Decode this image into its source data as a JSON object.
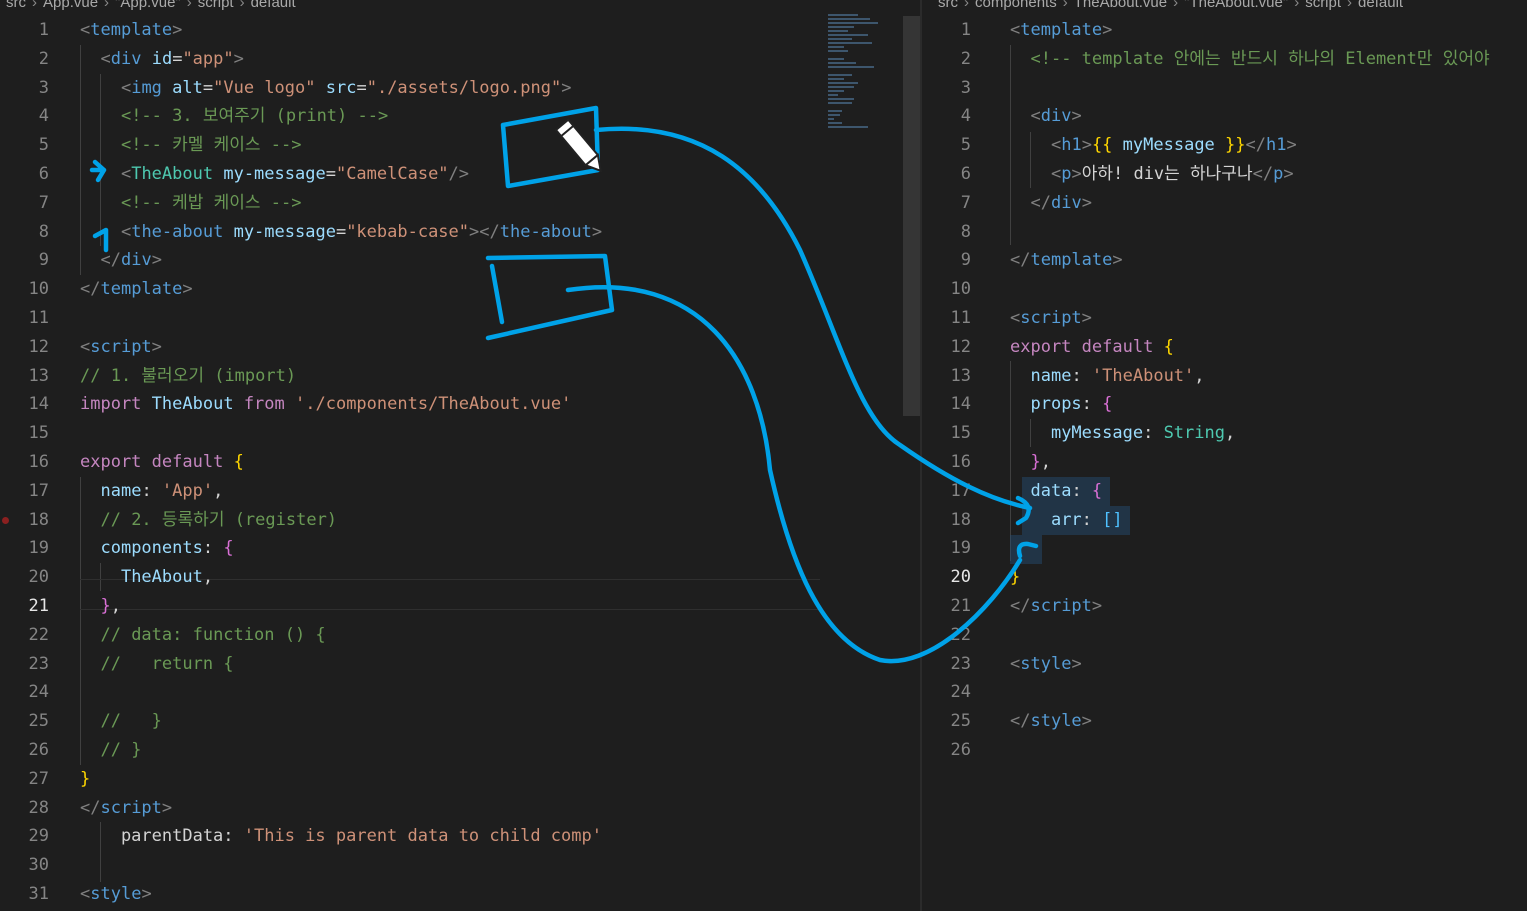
{
  "left_editor": {
    "breadcrumb": [
      "src",
      "App.vue",
      "\"App.vue\"",
      "script",
      "default"
    ],
    "active_line": 21,
    "lines": [
      {
        "n": 1,
        "segs": [
          [
            "t-br",
            "<"
          ],
          [
            "t-tag",
            "template"
          ],
          [
            "t-br",
            ">"
          ]
        ]
      },
      {
        "n": 2,
        "segs": [
          [
            "t-pl",
            "  "
          ],
          [
            "t-br",
            "<"
          ],
          [
            "t-tag",
            "div"
          ],
          [
            "t-pl",
            " "
          ],
          [
            "t-attr",
            "id"
          ],
          [
            "t-pl",
            "="
          ],
          [
            "t-str",
            "\"app\""
          ],
          [
            "t-br",
            ">"
          ]
        ]
      },
      {
        "n": 3,
        "segs": [
          [
            "t-pl",
            "    "
          ],
          [
            "t-br",
            "<"
          ],
          [
            "t-tag",
            "img"
          ],
          [
            "t-pl",
            " "
          ],
          [
            "t-attr",
            "alt"
          ],
          [
            "t-pl",
            "="
          ],
          [
            "t-str",
            "\"Vue logo\""
          ],
          [
            "t-pl",
            " "
          ],
          [
            "t-attr",
            "src"
          ],
          [
            "t-pl",
            "="
          ],
          [
            "t-str",
            "\"./assets/logo.png\""
          ],
          [
            "t-br",
            ">"
          ]
        ]
      },
      {
        "n": 4,
        "segs": [
          [
            "t-pl",
            "    "
          ],
          [
            "t-cmt",
            "<!-- 3. 보여주기 (print) -->"
          ]
        ]
      },
      {
        "n": 5,
        "segs": [
          [
            "t-pl",
            "    "
          ],
          [
            "t-cmt",
            "<!-- 카멜 케이스 -->"
          ]
        ]
      },
      {
        "n": 6,
        "segs": [
          [
            "t-pl",
            "    "
          ],
          [
            "t-br",
            "<"
          ],
          [
            "t-cls",
            "TheAbout"
          ],
          [
            "t-pl",
            " "
          ],
          [
            "t-attr",
            "my-message"
          ],
          [
            "t-pl",
            "="
          ],
          [
            "t-str",
            "\"CamelCase\""
          ],
          [
            "t-br",
            "/>"
          ]
        ]
      },
      {
        "n": 7,
        "segs": [
          [
            "t-pl",
            "    "
          ],
          [
            "t-cmt",
            "<!-- 케밥 케이스 -->"
          ]
        ]
      },
      {
        "n": 8,
        "segs": [
          [
            "t-pl",
            "    "
          ],
          [
            "t-br",
            "<"
          ],
          [
            "t-tag",
            "the-about"
          ],
          [
            "t-pl",
            " "
          ],
          [
            "t-attr",
            "my-message"
          ],
          [
            "t-pl",
            "="
          ],
          [
            "t-str",
            "\"kebab-case\""
          ],
          [
            "t-br",
            "></"
          ],
          [
            "t-tag",
            "the-about"
          ],
          [
            "t-br",
            ">"
          ]
        ]
      },
      {
        "n": 9,
        "segs": [
          [
            "t-pl",
            "  "
          ],
          [
            "t-br",
            "</"
          ],
          [
            "t-tag",
            "div"
          ],
          [
            "t-br",
            ">"
          ]
        ]
      },
      {
        "n": 10,
        "segs": [
          [
            "t-br",
            "</"
          ],
          [
            "t-tag",
            "template"
          ],
          [
            "t-br",
            ">"
          ]
        ]
      },
      {
        "n": 11,
        "segs": []
      },
      {
        "n": 12,
        "segs": [
          [
            "t-br",
            "<"
          ],
          [
            "t-tag",
            "script"
          ],
          [
            "t-br",
            ">"
          ]
        ]
      },
      {
        "n": 13,
        "segs": [
          [
            "t-cmt",
            "// 1. 불러오기 (import)"
          ]
        ]
      },
      {
        "n": 14,
        "segs": [
          [
            "t-kw",
            "import"
          ],
          [
            "t-pl",
            " "
          ],
          [
            "t-var",
            "TheAbout"
          ],
          [
            "t-pl",
            " "
          ],
          [
            "t-kw",
            "from"
          ],
          [
            "t-pl",
            " "
          ],
          [
            "t-str",
            "'./components/TheAbout.vue'"
          ]
        ]
      },
      {
        "n": 15,
        "segs": []
      },
      {
        "n": 16,
        "segs": [
          [
            "t-kw",
            "export"
          ],
          [
            "t-pl",
            " "
          ],
          [
            "t-kw",
            "default"
          ],
          [
            "t-pl",
            " "
          ],
          [
            "t-ye",
            "{"
          ]
        ]
      },
      {
        "n": 17,
        "segs": [
          [
            "t-pl",
            "  "
          ],
          [
            "t-var",
            "name"
          ],
          [
            "t-pl",
            ": "
          ],
          [
            "t-str",
            "'App'"
          ],
          [
            "t-pl",
            ","
          ]
        ]
      },
      {
        "n": 18,
        "segs": [
          [
            "t-pl",
            "  "
          ],
          [
            "t-cmt",
            "// 2. 등록하기 (register)"
          ]
        ]
      },
      {
        "n": 19,
        "segs": [
          [
            "t-pl",
            "  "
          ],
          [
            "t-var",
            "components"
          ],
          [
            "t-pl",
            ": "
          ],
          [
            "t-pu",
            "{"
          ]
        ]
      },
      {
        "n": 20,
        "segs": [
          [
            "t-pl",
            "    "
          ],
          [
            "t-var",
            "TheAbout"
          ],
          [
            "t-pl",
            ","
          ]
        ]
      },
      {
        "n": 21,
        "segs": [
          [
            "t-pl",
            "  "
          ],
          [
            "t-pu",
            "}"
          ],
          [
            "t-pl",
            ","
          ]
        ]
      },
      {
        "n": 22,
        "segs": [
          [
            "t-pl",
            "  "
          ],
          [
            "t-cmt",
            "// data: function () {"
          ]
        ]
      },
      {
        "n": 23,
        "segs": [
          [
            "t-pl",
            "  "
          ],
          [
            "t-cmt",
            "//   return {"
          ]
        ]
      },
      {
        "n": 24,
        "segs": []
      },
      {
        "n": 25,
        "segs": [
          [
            "t-pl",
            "  "
          ],
          [
            "t-cmt",
            "//   }"
          ]
        ]
      },
      {
        "n": 26,
        "segs": [
          [
            "t-pl",
            "  "
          ],
          [
            "t-cmt",
            "// }"
          ]
        ]
      },
      {
        "n": 27,
        "segs": [
          [
            "t-ye",
            "}"
          ]
        ]
      },
      {
        "n": 28,
        "segs": [
          [
            "t-br",
            "</"
          ],
          [
            "t-tag",
            "script"
          ],
          [
            "t-br",
            ">"
          ]
        ]
      },
      {
        "n": 29,
        "segs": [
          [
            "t-pl",
            "    parentData: "
          ],
          [
            "t-str",
            "'This is parent data to child comp'"
          ]
        ]
      },
      {
        "n": 30,
        "segs": []
      },
      {
        "n": 31,
        "segs": [
          [
            "t-br",
            "<"
          ],
          [
            "t-tag",
            "style"
          ],
          [
            "t-br",
            ">"
          ]
        ]
      }
    ]
  },
  "right_editor": {
    "breadcrumb": [
      "src",
      "components",
      "TheAbout.vue",
      "\"TheAbout.vue\"",
      "script",
      "default"
    ],
    "active_line": 20,
    "lines": [
      {
        "n": 1,
        "segs": [
          [
            "t-br",
            "<"
          ],
          [
            "t-tag",
            "template"
          ],
          [
            "t-br",
            ">"
          ]
        ]
      },
      {
        "n": 2,
        "segs": [
          [
            "t-pl",
            "  "
          ],
          [
            "t-cmt",
            "<!-- template 안에는 반드시 하나의 Element만 있어야"
          ]
        ]
      },
      {
        "n": 3,
        "segs": []
      },
      {
        "n": 4,
        "segs": [
          [
            "t-pl",
            "  "
          ],
          [
            "t-br",
            "<"
          ],
          [
            "t-tag",
            "div"
          ],
          [
            "t-br",
            ">"
          ]
        ]
      },
      {
        "n": 5,
        "segs": [
          [
            "t-pl",
            "    "
          ],
          [
            "t-br",
            "<"
          ],
          [
            "t-tag",
            "h1"
          ],
          [
            "t-br",
            ">"
          ],
          [
            "t-ye",
            "{{"
          ],
          [
            "t-pl",
            " "
          ],
          [
            "t-var",
            "myMessage"
          ],
          [
            "t-pl",
            " "
          ],
          [
            "t-ye",
            "}}"
          ],
          [
            "t-br",
            "</"
          ],
          [
            "t-tag",
            "h1"
          ],
          [
            "t-br",
            ">"
          ]
        ]
      },
      {
        "n": 6,
        "segs": [
          [
            "t-pl",
            "    "
          ],
          [
            "t-br",
            "<"
          ],
          [
            "t-tag",
            "p"
          ],
          [
            "t-br",
            ">"
          ],
          [
            "t-pl",
            "아하! div는 하나구나"
          ],
          [
            "t-br",
            "</"
          ],
          [
            "t-tag",
            "p"
          ],
          [
            "t-br",
            ">"
          ]
        ]
      },
      {
        "n": 7,
        "segs": [
          [
            "t-pl",
            "  "
          ],
          [
            "t-br",
            "</"
          ],
          [
            "t-tag",
            "div"
          ],
          [
            "t-br",
            ">"
          ]
        ]
      },
      {
        "n": 8,
        "segs": []
      },
      {
        "n": 9,
        "segs": [
          [
            "t-br",
            "</"
          ],
          [
            "t-tag",
            "template"
          ],
          [
            "t-br",
            ">"
          ]
        ]
      },
      {
        "n": 10,
        "segs": []
      },
      {
        "n": 11,
        "segs": [
          [
            "t-br",
            "<"
          ],
          [
            "t-tag",
            "script"
          ],
          [
            "t-br",
            ">"
          ]
        ]
      },
      {
        "n": 12,
        "segs": [
          [
            "t-kw",
            "export"
          ],
          [
            "t-pl",
            " "
          ],
          [
            "t-kw",
            "default"
          ],
          [
            "t-pl",
            " "
          ],
          [
            "t-ye",
            "{"
          ]
        ]
      },
      {
        "n": 13,
        "segs": [
          [
            "t-pl",
            "  "
          ],
          [
            "t-var",
            "name"
          ],
          [
            "t-pl",
            ": "
          ],
          [
            "t-str",
            "'TheAbout'"
          ],
          [
            "t-pl",
            ","
          ]
        ]
      },
      {
        "n": 14,
        "segs": [
          [
            "t-pl",
            "  "
          ],
          [
            "t-var",
            "props"
          ],
          [
            "t-pl",
            ": "
          ],
          [
            "t-pu",
            "{"
          ]
        ]
      },
      {
        "n": 15,
        "segs": [
          [
            "t-pl",
            "    "
          ],
          [
            "t-var",
            "myMessage"
          ],
          [
            "t-pl",
            ": "
          ],
          [
            "t-cls",
            "String"
          ],
          [
            "t-pl",
            ","
          ]
        ]
      },
      {
        "n": 16,
        "segs": [
          [
            "t-pl",
            "  "
          ],
          [
            "t-pu",
            "}"
          ],
          [
            "t-pl",
            ","
          ]
        ]
      },
      {
        "n": 17,
        "segs": [
          [
            "t-pl",
            "  "
          ],
          [
            "t-var",
            "data"
          ],
          [
            "t-pl",
            ": "
          ],
          [
            "t-pu",
            "{"
          ]
        ]
      },
      {
        "n": 18,
        "segs": [
          [
            "t-pl",
            "    "
          ],
          [
            "t-var",
            "arr"
          ],
          [
            "t-pl",
            ": "
          ],
          [
            "t-pk",
            "[]"
          ]
        ]
      },
      {
        "n": 19,
        "segs": []
      },
      {
        "n": 20,
        "segs": [
          [
            "t-ye",
            "}"
          ]
        ]
      },
      {
        "n": 21,
        "segs": [
          [
            "t-br",
            "</"
          ],
          [
            "t-tag",
            "script"
          ],
          [
            "t-br",
            ">"
          ]
        ]
      },
      {
        "n": 22,
        "segs": []
      },
      {
        "n": 23,
        "segs": [
          [
            "t-br",
            "<"
          ],
          [
            "t-tag",
            "style"
          ],
          [
            "t-br",
            ">"
          ]
        ]
      },
      {
        "n": 24,
        "segs": []
      },
      {
        "n": 25,
        "segs": [
          [
            "t-br",
            "</"
          ],
          [
            "t-tag",
            "style"
          ],
          [
            "t-br",
            ">"
          ]
        ]
      },
      {
        "n": 26,
        "segs": []
      }
    ]
  },
  "annotation": {
    "stroke_color": "#00a2e8",
    "cursor_icon": "pencil-cursor-icon"
  }
}
